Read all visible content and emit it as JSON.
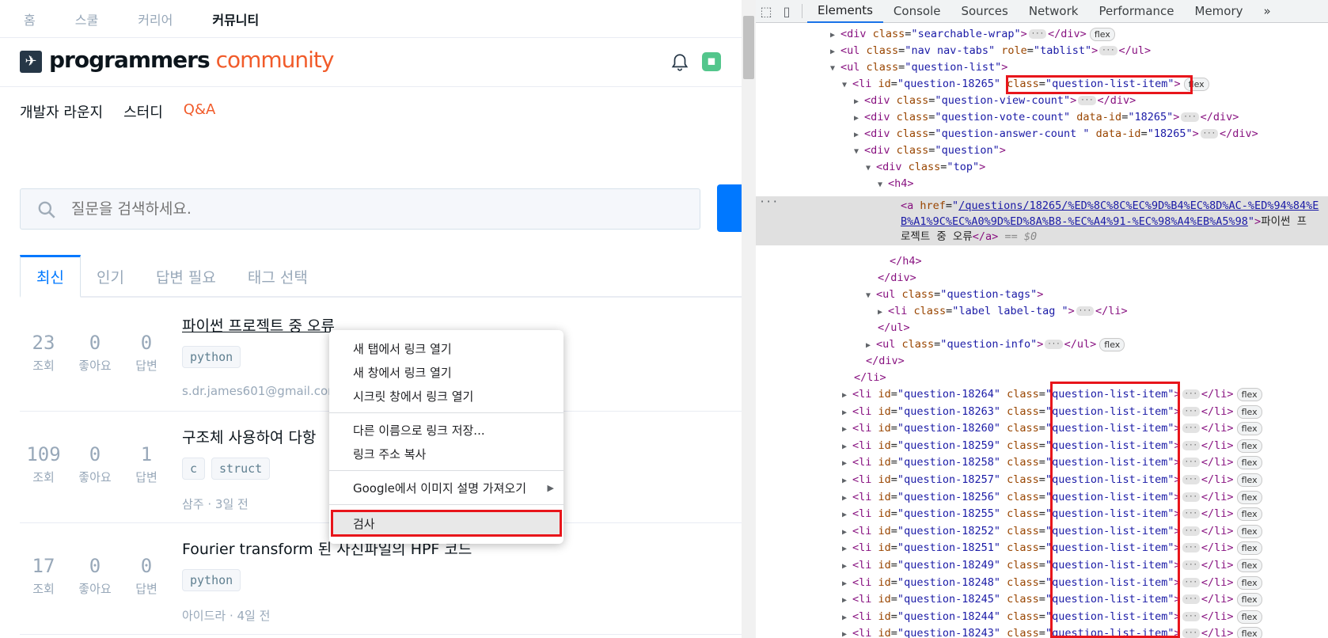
{
  "left": {
    "topnav": [
      "홈",
      "스쿨",
      "커리어",
      "커뮤니티"
    ],
    "logo": {
      "bold": "programmers",
      "accent": "community"
    },
    "subnav": [
      "개발자 라운지",
      "스터디",
      "Q&A"
    ],
    "search": {
      "placeholder": "질문을 검색하세요."
    },
    "tabs": [
      "최신",
      "인기",
      "답변 필요",
      "태그 선택"
    ],
    "stat_labels": {
      "views": "조회",
      "likes": "좋아요",
      "answers": "답변"
    },
    "questions": [
      {
        "views": "23",
        "likes": "0",
        "answers": "0",
        "title": "파이썬 프로젝트 중 오류",
        "tags": [
          "python"
        ],
        "info": "s.dr.james601@gmail.com"
      },
      {
        "views": "109",
        "likes": "0",
        "answers": "1",
        "title": "구조체 사용하여 다항",
        "tags": [
          "c",
          "struct"
        ],
        "info": "삼주 · 3일 전"
      },
      {
        "views": "17",
        "likes": "0",
        "answers": "0",
        "title": "Fourier transform 된 사진파일의 HPF 코드",
        "tags": [
          "python"
        ],
        "info": "아이드라 · 4일 전"
      }
    ]
  },
  "context_menu": {
    "items": [
      "새 탭에서 링크 열기",
      "새 창에서 링크 열기",
      "시크릿 창에서 링크 열기",
      "다른 이름으로 링크 저장...",
      "링크 주소 복사",
      "Google에서 이미지 설명 가져오기",
      "검사"
    ]
  },
  "devtools": {
    "tabs": [
      "Elements",
      "Console",
      "Sources",
      "Network",
      "Performance",
      "Memory",
      "»"
    ],
    "lines": {
      "searchable": {
        "tag": "div",
        "cls": "searchable-wrap",
        "badge": "flex"
      },
      "navtabs": {
        "cls": "nav nav-tabs",
        "role": "tablist"
      },
      "qlist": {
        "cls": "question-list"
      },
      "li_open": {
        "id": "question-18265",
        "cls": "question-list-item",
        "badge": "flex"
      },
      "viewcount": {
        "cls": "question-view-count"
      },
      "votecount": {
        "cls": "question-vote-count",
        "dataid": "18265"
      },
      "answercount": {
        "cls": "question-answer-count ",
        "dataid": "18265"
      },
      "question": {
        "cls": "question"
      },
      "top": {
        "cls": "top"
      },
      "href1": "/questions/18265/%ED%8C%8C%EC%9D%B4%EC%8D%AC-%ED%94%84%E",
      "href2": "B%A1%9C%EC%A0%9D%ED%8A%B8-%EC%A4%91-%EC%98%A4%EB%A5%98",
      "text1": "파이썬 프",
      "text2": "로젝트 중 오류",
      "dollar": "== $0",
      "tags": {
        "cls": "question-tags"
      },
      "labeltag": {
        "cls": "label label-tag "
      },
      "info": {
        "cls": "question-info",
        "badge": "flex"
      }
    },
    "items": [
      "question-18264",
      "question-18263",
      "question-18260",
      "question-18259",
      "question-18258",
      "question-18257",
      "question-18256",
      "question-18255",
      "question-18252",
      "question-18251",
      "question-18249",
      "question-18248",
      "question-18245",
      "question-18244",
      "question-18243"
    ],
    "item_class": "question-list-item",
    "item_badge": "flex"
  },
  "colors": {
    "accent": "#f15b2a",
    "brand_blue": "#0078ff",
    "highlight_red": "#e8151b"
  }
}
